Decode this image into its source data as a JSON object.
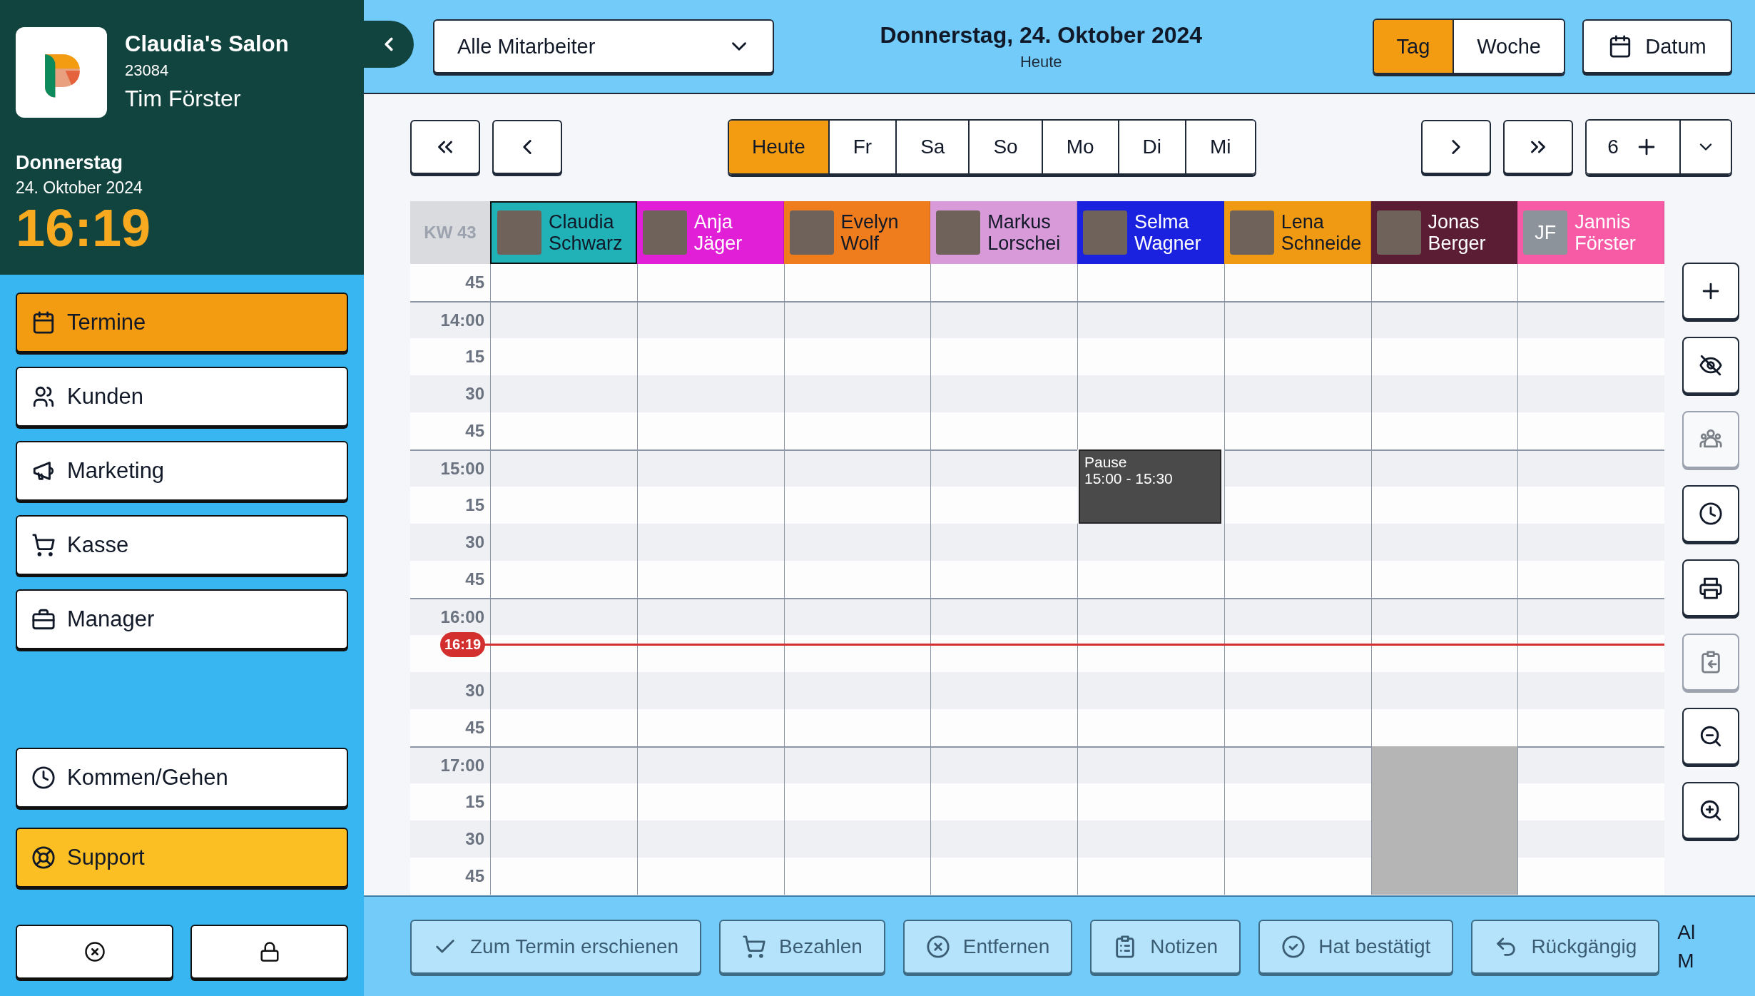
{
  "sidebar": {
    "salon_name": "Claudia's Salon",
    "salon_id": "23084",
    "user_name": "Tim Förster",
    "weekday": "Donnerstag",
    "date": "24. Oktober 2024",
    "time": "16:19",
    "nav": [
      {
        "label": "Termine",
        "selected": true
      },
      {
        "label": "Kunden",
        "selected": false
      },
      {
        "label": "Marketing",
        "selected": false
      },
      {
        "label": "Kasse",
        "selected": false
      },
      {
        "label": "Manager",
        "selected": false
      }
    ],
    "bottom_nav": [
      {
        "label": "Kommen/Gehen",
        "kind": "plain"
      },
      {
        "label": "Support",
        "kind": "highlight"
      }
    ]
  },
  "topbar": {
    "staff_filter": "Alle Mitarbeiter",
    "title": "Donnerstag, 24. Oktober 2024",
    "subtitle": "Heute",
    "view_tabs": [
      {
        "label": "Tag",
        "selected": true
      },
      {
        "label": "Woche",
        "selected": false
      }
    ],
    "date_button": "Datum"
  },
  "day_nav": {
    "days": [
      {
        "label": "Heute",
        "selected": true
      },
      {
        "label": "Fr",
        "selected": false
      },
      {
        "label": "Sa",
        "selected": false
      },
      {
        "label": "So",
        "selected": false
      },
      {
        "label": "Mo",
        "selected": false
      },
      {
        "label": "Di",
        "selected": false
      },
      {
        "label": "Mi",
        "selected": false
      }
    ],
    "count": "6"
  },
  "calendar": {
    "week_label": "KW 43",
    "now_label": "16:19",
    "staff": [
      {
        "name": "Claudia Schwarz",
        "color": "#20b2b6",
        "selected": true
      },
      {
        "name": "Anja Jäger",
        "color": "#e11fd7",
        "selected": false
      },
      {
        "name": "Evelyn Wolf",
        "color": "#ef7d1e",
        "selected": false
      },
      {
        "name": "Markus Lorschei",
        "color": "#d89ad8",
        "selected": false
      },
      {
        "name": "Selma Wagner",
        "color": "#1a22e0",
        "selected": false
      },
      {
        "name": "Lena Schneide",
        "color": "#ef9a12",
        "selected": false
      },
      {
        "name": "Jonas Berger",
        "color": "#5a1d33",
        "selected": false
      },
      {
        "name": "Jannis Förster",
        "color": "#f85ba6",
        "selected": false,
        "initials": "JF"
      }
    ],
    "rows": [
      {
        "kind": "quarter",
        "label": "45",
        "cells": [
          {
            "kind": "free"
          },
          {
            "kind": "free"
          },
          {
            "kind": "free"
          },
          {
            "kind": "free"
          },
          {
            "kind": "free"
          },
          {
            "kind": "free"
          },
          {
            "kind": "free"
          },
          {
            "kind": "free"
          }
        ]
      },
      {
        "kind": "hour",
        "label": "14:00",
        "cells": [
          {
            "kind": "free"
          },
          {
            "kind": "free"
          },
          {
            "kind": "free"
          },
          {
            "kind": "free"
          },
          {
            "kind": "free"
          },
          {
            "kind": "free"
          },
          {
            "kind": "free"
          },
          {
            "kind": "free"
          }
        ]
      },
      {
        "kind": "quarter",
        "label": "15",
        "cells": [
          {
            "kind": "free"
          },
          {
            "kind": "free"
          },
          {
            "kind": "free"
          },
          {
            "kind": "free"
          },
          {
            "kind": "free"
          },
          {
            "kind": "free"
          },
          {
            "kind": "free"
          },
          {
            "kind": "free"
          }
        ]
      },
      {
        "kind": "half",
        "label": "30",
        "cells": [
          {
            "kind": "free"
          },
          {
            "kind": "free"
          },
          {
            "kind": "free"
          },
          {
            "kind": "free"
          },
          {
            "kind": "free"
          },
          {
            "kind": "free"
          },
          {
            "kind": "free"
          },
          {
            "kind": "free"
          }
        ]
      },
      {
        "kind": "quarter",
        "label": "45",
        "cells": [
          {
            "kind": "free"
          },
          {
            "kind": "free"
          },
          {
            "kind": "free"
          },
          {
            "kind": "free"
          },
          {
            "kind": "free"
          },
          {
            "kind": "free"
          },
          {
            "kind": "free"
          },
          {
            "kind": "free"
          }
        ]
      },
      {
        "kind": "hour",
        "label": "15:00",
        "cells": [
          {
            "kind": "free"
          },
          {
            "kind": "free"
          },
          {
            "kind": "free"
          },
          {
            "kind": "free"
          },
          {
            "kind": "break",
            "title": "Pause",
            "time": "15:00 - 15:30"
          },
          {
            "kind": "free"
          },
          {
            "kind": "free"
          },
          {
            "kind": "free"
          }
        ]
      },
      {
        "kind": "quarter",
        "label": "15",
        "cells": [
          {
            "kind": "free"
          },
          {
            "kind": "free"
          },
          {
            "kind": "free"
          },
          {
            "kind": "free"
          },
          {
            "kind": "break"
          },
          {
            "kind": "free"
          },
          {
            "kind": "free"
          },
          {
            "kind": "free"
          }
        ]
      },
      {
        "kind": "half",
        "label": "30",
        "cells": [
          {
            "kind": "free"
          },
          {
            "kind": "free"
          },
          {
            "kind": "free"
          },
          {
            "kind": "free"
          },
          {
            "kind": "free"
          },
          {
            "kind": "free"
          },
          {
            "kind": "free"
          },
          {
            "kind": "free"
          }
        ]
      },
      {
        "kind": "quarter",
        "label": "45",
        "cells": [
          {
            "kind": "free"
          },
          {
            "kind": "free"
          },
          {
            "kind": "free"
          },
          {
            "kind": "free"
          },
          {
            "kind": "free"
          },
          {
            "kind": "free"
          },
          {
            "kind": "free"
          },
          {
            "kind": "free"
          }
        ]
      },
      {
        "kind": "hour",
        "label": "16:00",
        "cells": [
          {
            "kind": "free"
          },
          {
            "kind": "free"
          },
          {
            "kind": "free"
          },
          {
            "kind": "free"
          },
          {
            "kind": "free"
          },
          {
            "kind": "free"
          },
          {
            "kind": "free"
          },
          {
            "kind": "free"
          }
        ]
      },
      {
        "kind": "quarter",
        "now": true,
        "cells": [
          {
            "kind": "free"
          },
          {
            "kind": "free"
          },
          {
            "kind": "free"
          },
          {
            "kind": "free"
          },
          {
            "kind": "free"
          },
          {
            "kind": "free"
          },
          {
            "kind": "free"
          },
          {
            "kind": "free"
          }
        ]
      },
      {
        "kind": "half",
        "label": "30",
        "cells": [
          {
            "kind": "free"
          },
          {
            "kind": "free"
          },
          {
            "kind": "free"
          },
          {
            "kind": "free"
          },
          {
            "kind": "free"
          },
          {
            "kind": "free"
          },
          {
            "kind": "free"
          },
          {
            "kind": "free"
          }
        ]
      },
      {
        "kind": "quarter",
        "label": "45",
        "cells": [
          {
            "kind": "free"
          },
          {
            "kind": "free"
          },
          {
            "kind": "free"
          },
          {
            "kind": "free"
          },
          {
            "kind": "free"
          },
          {
            "kind": "free"
          },
          {
            "kind": "free"
          },
          {
            "kind": "free"
          }
        ]
      },
      {
        "kind": "hour",
        "label": "17:00",
        "cells": [
          {
            "kind": "free"
          },
          {
            "kind": "free"
          },
          {
            "kind": "free"
          },
          {
            "kind": "free"
          },
          {
            "kind": "free"
          },
          {
            "kind": "free"
          },
          {
            "kind": "unavailable"
          },
          {
            "kind": "free"
          }
        ]
      },
      {
        "kind": "quarter",
        "label": "15",
        "cells": [
          {
            "kind": "free"
          },
          {
            "kind": "free"
          },
          {
            "kind": "free"
          },
          {
            "kind": "free"
          },
          {
            "kind": "free"
          },
          {
            "kind": "free"
          },
          {
            "kind": "unavailable"
          },
          {
            "kind": "free"
          }
        ]
      },
      {
        "kind": "half",
        "label": "30",
        "cells": [
          {
            "kind": "free"
          },
          {
            "kind": "free"
          },
          {
            "kind": "free"
          },
          {
            "kind": "free"
          },
          {
            "kind": "free"
          },
          {
            "kind": "free"
          },
          {
            "kind": "unavailable"
          },
          {
            "kind": "free"
          }
        ]
      },
      {
        "kind": "quarter",
        "label": "45",
        "cells": [
          {
            "kind": "free"
          },
          {
            "kind": "free"
          },
          {
            "kind": "free"
          },
          {
            "kind": "free"
          },
          {
            "kind": "free"
          },
          {
            "kind": "free"
          },
          {
            "kind": "unavailable"
          },
          {
            "kind": "free"
          }
        ]
      }
    ]
  },
  "toolbar": [
    {
      "disabled": false
    },
    {
      "disabled": false
    },
    {
      "disabled": true
    },
    {
      "disabled": false
    },
    {
      "disabled": false
    },
    {
      "disabled": true
    },
    {
      "disabled": false
    },
    {
      "disabled": false
    }
  ],
  "action_bar": {
    "actions": [
      "Zum Termin erschienen",
      "Bezahlen",
      "Entfernen",
      "Notizen",
      "Hat bestätigt",
      "Rückgängig"
    ],
    "overflow_text": [
      "Al",
      "M"
    ]
  }
}
